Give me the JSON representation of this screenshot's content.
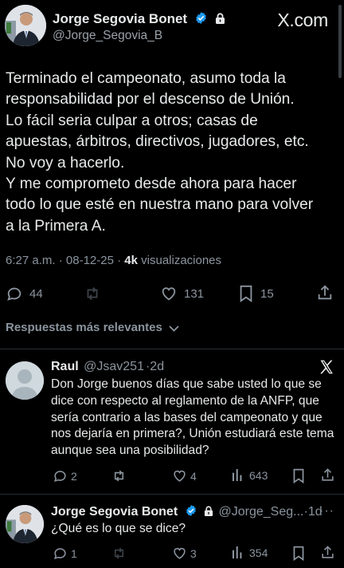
{
  "header": {
    "author_name": "Jorge Segovia Bonet",
    "author_handle": "@Jorge_Segovia_B",
    "site_logo": "X.com",
    "verified_icon": "verified-badge-icon",
    "lock_icon": "lock-icon"
  },
  "tweet": {
    "paragraphs": [
      "Terminado el campeonato, asumo toda la responsabilidad por el descenso de Unión.",
      "Lo fácil seria culpar a otros; casas de apuestas, árbitros, directivos, jugadores, etc. No voy a hacerlo.",
      "Y me comprometo desde ahora para hacer todo lo que esté en nuestra mano para volver a la Primera A."
    ],
    "time": "6:27 a.m.",
    "date": "08-12-25",
    "views_count": "4k",
    "views_label": "visualizaciones",
    "actions": {
      "replies": "44",
      "retweets": "",
      "likes": "131",
      "bookmarks": "15"
    }
  },
  "replies_section": {
    "label": "Respuestas más relevantes"
  },
  "replies": [
    {
      "name": "Raul",
      "handle": "@Jsav251",
      "time": "2d",
      "text": "Don Jorge buenos días que sabe usted lo que se dice con respecto al reglamento de la ANFP, que sería contrario a las bases del campeonato y que nos dejaría en primera?, Unión estudiará este tema aunque sea una posibilidad?",
      "replies": "2",
      "likes": "4",
      "views": "643"
    },
    {
      "name": "Jorge Segovia Bonet",
      "handle": "@Jorge_Seg...",
      "time": "1d",
      "text": "¿Qué es lo que se dice?",
      "replies": "1",
      "likes": "3",
      "views": "354"
    }
  ],
  "colors": {
    "background": "#000000",
    "text": "#e7e9ea",
    "muted": "#8b949e",
    "verified": "#1d9bf0",
    "divider": "#2a2f33"
  }
}
